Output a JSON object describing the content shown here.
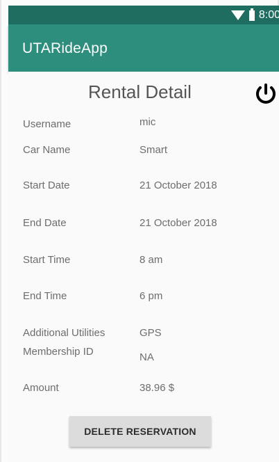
{
  "status_bar": {
    "time": "8:00"
  },
  "app_bar": {
    "title": "UTARideApp"
  },
  "page": {
    "title": "Rental Detail"
  },
  "details": [
    {
      "label": "Username",
      "value": "mic"
    },
    {
      "label": "Car Name",
      "value": "Smart"
    },
    {
      "label": "Start Date",
      "value": "21 October 2018"
    },
    {
      "label": "End Date",
      "value": "21 October 2018"
    },
    {
      "label": "Start Time",
      "value": "8 am"
    },
    {
      "label": "End Time",
      "value": "6 pm"
    },
    {
      "label": "Additional Utilities",
      "value": "GPS"
    },
    {
      "label": "Membership ID",
      "value": "NA"
    },
    {
      "label": "Amount",
      "value": "38.96 $"
    }
  ],
  "actions": {
    "delete_label": "DELETE RESERVATION"
  },
  "icons": {
    "power": "power-icon",
    "wifi": "wifi-icon",
    "battery": "battery-icon"
  },
  "colors": {
    "app_bar": "#2e8e7d",
    "status_bar": "#1f6d60"
  }
}
